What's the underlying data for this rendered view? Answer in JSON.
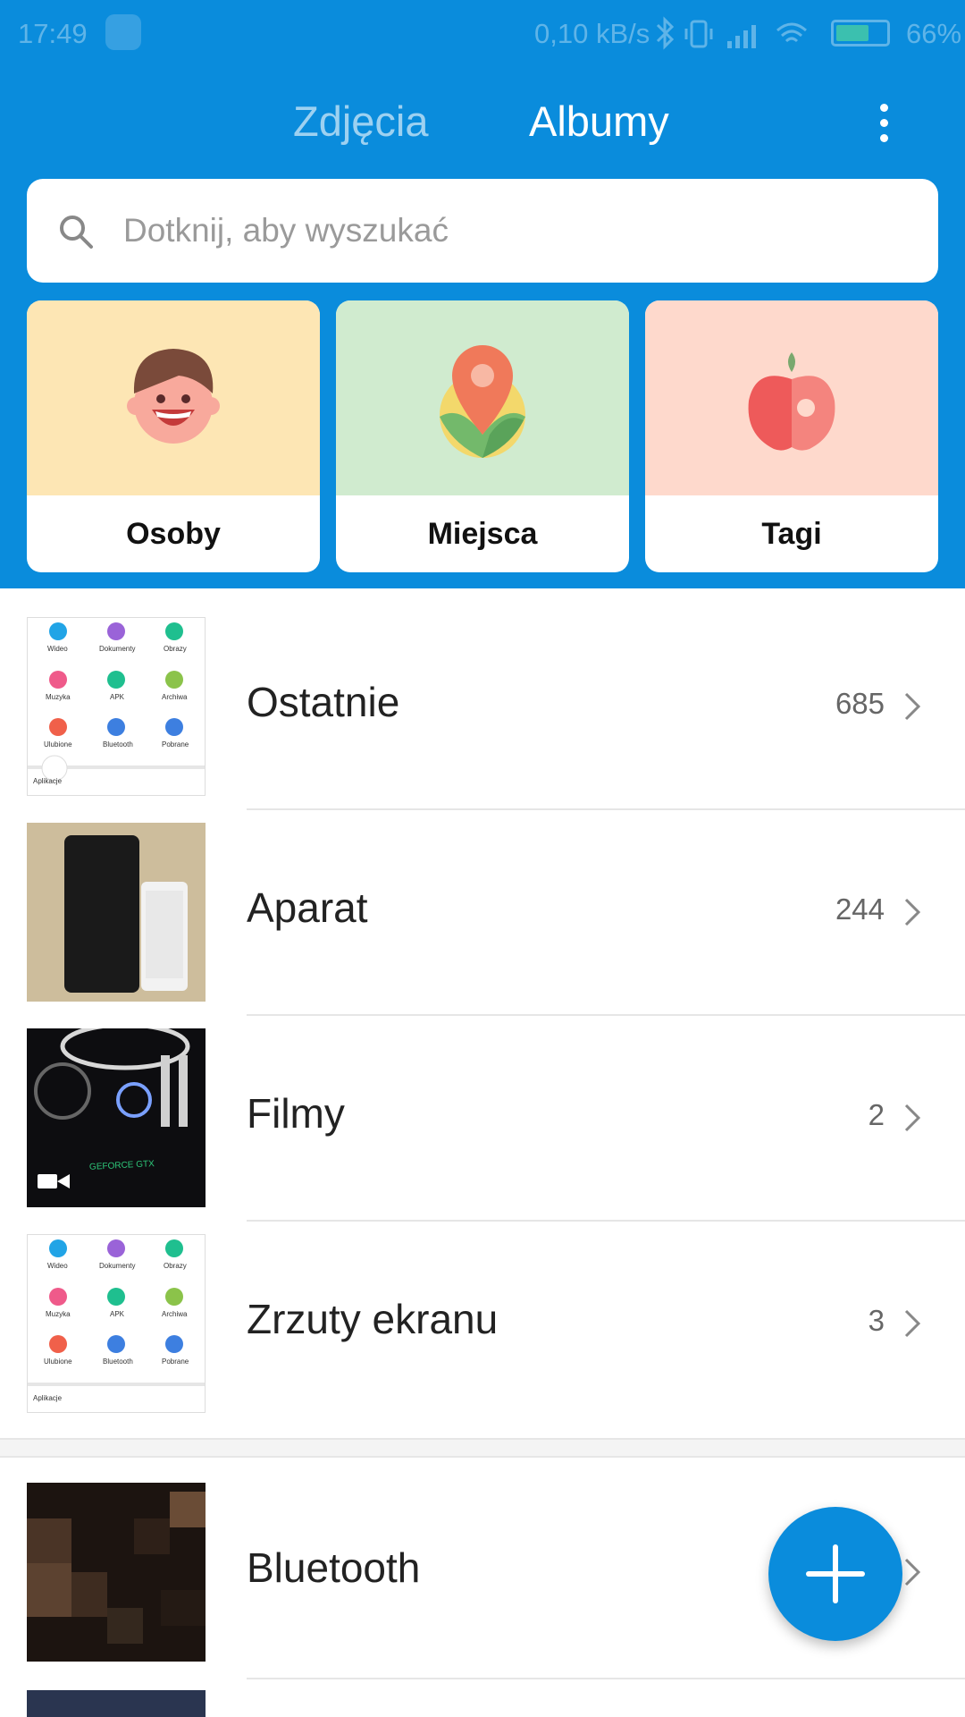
{
  "status_bar": {
    "time": "17:49",
    "speed": "0,10 kB/s",
    "battery_level": 0.66,
    "battery_percent": "66%"
  },
  "tabs": {
    "photos": "Zdjęcia",
    "albums": "Albumy",
    "active": "Albumy"
  },
  "search": {
    "placeholder": "Dotknij, aby wyszukać"
  },
  "categories": [
    {
      "label": "Osoby",
      "icon": "face-icon",
      "color": "#fde6b4"
    },
    {
      "label": "Miejsca",
      "icon": "location-pin-icon",
      "color": "#d0ebcf"
    },
    {
      "label": "Tagi",
      "icon": "apple-icon",
      "color": "#fed9cc"
    }
  ],
  "albums": [
    {
      "name": "Ostatnie",
      "count": "685",
      "thumb": "screenshot-thumbnail"
    },
    {
      "name": "Aparat",
      "count": "244",
      "thumb": "devices-photo"
    },
    {
      "name": "Filmy",
      "count": "2",
      "thumb": "pc-video-thumbnail"
    },
    {
      "name": "Zrzuty ekranu",
      "count": "3",
      "thumb": "screenshot-thumbnail"
    },
    {
      "name": "Bluetooth",
      "count": "",
      "thumb": "pixelated-photo"
    }
  ],
  "thumb_labels": {
    "apps": "Aplikacje",
    "wideo": "Wideo",
    "dokumenty": "Dokumenty",
    "obrazy": "Obrazy",
    "muzyka": "Muzyka",
    "apk": "APK",
    "archiwa": "Archiwa",
    "ulubione": "Ulubione",
    "bluetooth": "Bluetooth",
    "pobrane": "Pobrane",
    "geforce": "GEFORCE GTX"
  },
  "colors": {
    "accent": "#0a8cdc",
    "fab": "#0a8cdc"
  }
}
